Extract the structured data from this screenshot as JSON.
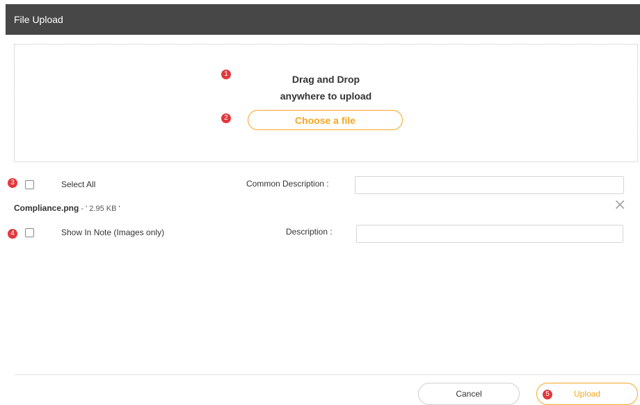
{
  "header": {
    "title": "File Upload"
  },
  "dropzone": {
    "line1": "Drag and Drop",
    "line2": "anywhere to upload",
    "choose_label": "Choose a file"
  },
  "badges": {
    "b1": "1",
    "b2": "2",
    "b3": "3",
    "b4": "4",
    "b5": "5"
  },
  "options": {
    "select_all_label": "Select All",
    "common_description_label": "Common Description :",
    "common_description_value": ""
  },
  "file": {
    "name": "Compliance.png",
    "size_text": " - ' 2.95 KB '",
    "show_in_note_label": "Show In Note (Images only)",
    "description_label": "Description :",
    "description_value": ""
  },
  "footer": {
    "cancel_label": "Cancel",
    "upload_label": "Upload"
  },
  "colors": {
    "accent": "#f5a623",
    "badge": "#e0393e",
    "header": "#474747"
  },
  "icons": {
    "remove": "close-icon"
  }
}
